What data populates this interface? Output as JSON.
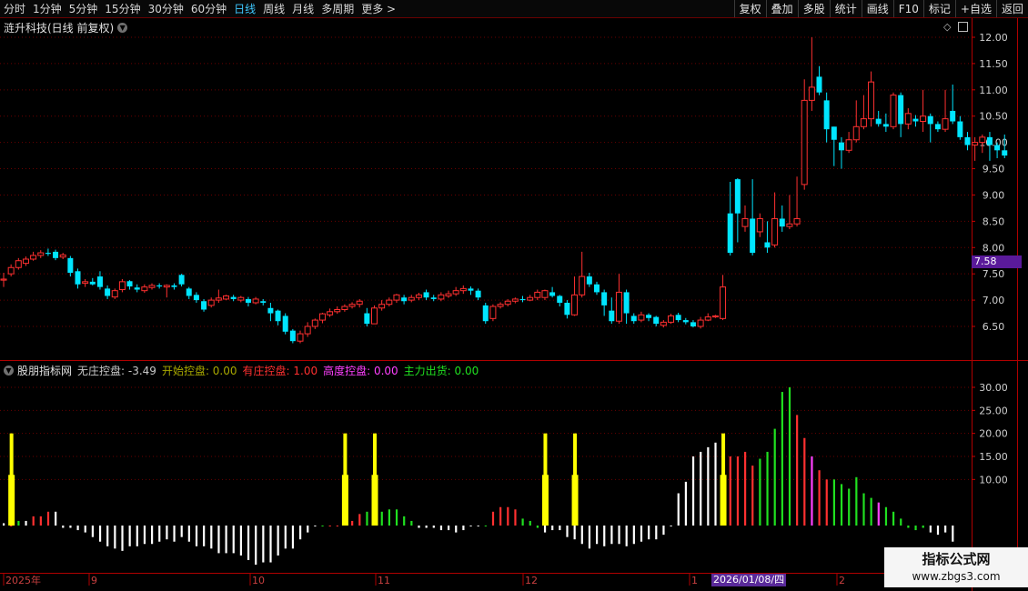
{
  "toolbar": {
    "periods": [
      "分时",
      "1分钟",
      "5分钟",
      "15分钟",
      "30分钟",
      "60分钟",
      "日线",
      "周线",
      "月线",
      "多周期",
      "更多 >"
    ],
    "active_period": "日线",
    "actions": [
      "复权",
      "叠加",
      "多股",
      "统计",
      "画线",
      "F10",
      "标记",
      "+自选",
      "返回"
    ]
  },
  "main_panel": {
    "title": "涟升科技(日线 前复权)",
    "current_price_label": "7.58",
    "price_axis_ticks": [
      "12.00",
      "11.50",
      "11.00",
      "10.50",
      "10.00",
      "9.50",
      "9.00",
      "8.50",
      "8.00",
      "7.50",
      "7.00",
      "6.50"
    ]
  },
  "indicator_panel": {
    "name": "股朋指标网",
    "values": [
      {
        "label": "无庄控盘:",
        "value": "-3.49",
        "color": "#c8c8c8"
      },
      {
        "label": "开始控盘:",
        "value": "0.00",
        "color": "#a8a800"
      },
      {
        "label": "有庄控盘:",
        "value": "1.00",
        "color": "#ff3030"
      },
      {
        "label": "高度控盘:",
        "value": "0.00",
        "color": "#ff40ff"
      },
      {
        "label": "主力出货:",
        "value": "0.00",
        "color": "#20e020"
      }
    ],
    "axis_ticks": [
      "30.00",
      "25.00",
      "20.00",
      "15.00",
      "10.00"
    ]
  },
  "time_axis": {
    "labels": [
      "2025年",
      "9",
      "10",
      "11",
      "12",
      "1",
      "2"
    ],
    "cursor_date": "2026/01/08/四"
  },
  "watermark": {
    "title": "指标公式网",
    "url": "www.zbgs3.com"
  },
  "colors": {
    "up": "#ff3030",
    "down": "#00e5ff",
    "grid": "#6a0000",
    "bg": "#000000"
  },
  "chart_data": [
    {
      "type": "candlestick",
      "ylim": [
        6.1,
        12.25
      ],
      "note_values_order": "open, close, high, low",
      "candles": [
        [
          7.38,
          7.4,
          7.52,
          7.25
        ],
        [
          7.5,
          7.62,
          7.68,
          7.45
        ],
        [
          7.62,
          7.75,
          7.8,
          7.58
        ],
        [
          7.7,
          7.78,
          7.83,
          7.65
        ],
        [
          7.78,
          7.85,
          7.92,
          7.75
        ],
        [
          7.85,
          7.9,
          7.95,
          7.8
        ],
        [
          7.9,
          7.88,
          7.98,
          7.84
        ],
        [
          7.92,
          7.8,
          7.96,
          7.76
        ],
        [
          7.82,
          7.86,
          7.9,
          7.78
        ],
        [
          7.8,
          7.52,
          7.84,
          7.45
        ],
        [
          7.55,
          7.3,
          7.6,
          7.22
        ],
        [
          7.32,
          7.35,
          7.4,
          7.25
        ],
        [
          7.35,
          7.3,
          7.42,
          7.28
        ],
        [
          7.45,
          7.25,
          7.55,
          7.2
        ],
        [
          7.22,
          7.08,
          7.28,
          7.02
        ],
        [
          7.06,
          7.18,
          7.22,
          7.02
        ],
        [
          7.2,
          7.35,
          7.4,
          7.15
        ],
        [
          7.36,
          7.26,
          7.38,
          7.2
        ],
        [
          7.24,
          7.2,
          7.3,
          7.15
        ],
        [
          7.18,
          7.25,
          7.3,
          7.14
        ],
        [
          7.24,
          7.28,
          7.32,
          7.2
        ],
        [
          7.28,
          7.26,
          7.32,
          7.22
        ],
        [
          7.25,
          7.28,
          7.3,
          7.05
        ],
        [
          7.28,
          7.25,
          7.32,
          7.2
        ],
        [
          7.48,
          7.3,
          7.5,
          7.26
        ],
        [
          7.22,
          7.08,
          7.25,
          7.02
        ],
        [
          7.1,
          7.0,
          7.15,
          6.95
        ],
        [
          6.98,
          6.82,
          7.02,
          6.78
        ],
        [
          6.9,
          7.0,
          7.05,
          6.86
        ],
        [
          7.0,
          7.04,
          7.2,
          6.95
        ],
        [
          7.02,
          7.08,
          7.1,
          7.0
        ],
        [
          7.06,
          7.02,
          7.1,
          6.98
        ],
        [
          7.0,
          7.05,
          7.08,
          6.96
        ],
        [
          7.02,
          6.95,
          7.06,
          6.88
        ],
        [
          6.95,
          7.02,
          7.06,
          6.92
        ],
        [
          6.98,
          6.95,
          7.02,
          6.9
        ],
        [
          6.85,
          6.75,
          6.95,
          6.6
        ],
        [
          6.8,
          6.6,
          6.82,
          6.52
        ],
        [
          6.7,
          6.4,
          6.75,
          6.35
        ],
        [
          6.42,
          6.22,
          6.45,
          6.18
        ],
        [
          6.22,
          6.36,
          6.42,
          6.18
        ],
        [
          6.36,
          6.5,
          6.58,
          6.3
        ],
        [
          6.5,
          6.62,
          6.65,
          6.45
        ],
        [
          6.62,
          6.74,
          6.76,
          6.56
        ],
        [
          6.72,
          6.78,
          6.84,
          6.68
        ],
        [
          6.78,
          6.82,
          6.88,
          6.74
        ],
        [
          6.82,
          6.88,
          6.92,
          6.78
        ],
        [
          6.88,
          6.92,
          6.96,
          6.84
        ],
        [
          6.92,
          6.98,
          7.02,
          6.86
        ],
        [
          6.75,
          6.55,
          6.85,
          6.5
        ],
        [
          6.55,
          6.85,
          6.9,
          6.55
        ],
        [
          6.85,
          6.92,
          7.0,
          6.8
        ],
        [
          6.92,
          7.0,
          7.05,
          6.88
        ],
        [
          7.0,
          7.1,
          7.12,
          6.95
        ],
        [
          7.05,
          6.98,
          7.1,
          6.92
        ],
        [
          7.0,
          7.05,
          7.1,
          6.96
        ],
        [
          7.05,
          7.1,
          7.14,
          7.0
        ],
        [
          7.15,
          7.05,
          7.2,
          7.0
        ],
        [
          7.05,
          7.02,
          7.1,
          6.98
        ],
        [
          7.02,
          7.1,
          7.15,
          6.98
        ],
        [
          7.08,
          7.12,
          7.18,
          7.04
        ],
        [
          7.12,
          7.18,
          7.25,
          7.08
        ],
        [
          7.18,
          7.22,
          7.28,
          7.12
        ],
        [
          7.22,
          7.18,
          7.26,
          7.1
        ],
        [
          7.18,
          7.05,
          7.22,
          7.0
        ],
        [
          6.9,
          6.6,
          6.95,
          6.55
        ],
        [
          6.65,
          6.88,
          6.92,
          6.6
        ],
        [
          6.88,
          6.92,
          6.96,
          6.84
        ],
        [
          6.92,
          6.98,
          7.02,
          6.88
        ],
        [
          6.98,
          7.02,
          7.05,
          6.94
        ],
        [
          7.02,
          7.0,
          7.08,
          6.96
        ],
        [
          7.0,
          7.05,
          7.1,
          6.98
        ],
        [
          7.05,
          7.15,
          7.2,
          7.0
        ],
        [
          7.05,
          7.18,
          7.2,
          7.0
        ],
        [
          7.15,
          7.08,
          7.25,
          7.05
        ],
        [
          7.08,
          6.95,
          7.1,
          6.88
        ],
        [
          6.95,
          6.72,
          7.0,
          6.65
        ],
        [
          6.72,
          7.1,
          7.45,
          6.7
        ],
        [
          7.1,
          7.45,
          7.92,
          7.05
        ],
        [
          7.45,
          7.3,
          7.52,
          7.25
        ],
        [
          7.3,
          7.15,
          7.35,
          7.1
        ],
        [
          7.15,
          6.9,
          7.2,
          6.7
        ],
        [
          6.8,
          6.6,
          7.05,
          6.55
        ],
        [
          6.6,
          7.15,
          7.5,
          6.55
        ],
        [
          7.15,
          6.75,
          7.2,
          6.55
        ],
        [
          6.7,
          6.6,
          6.75,
          6.55
        ],
        [
          6.62,
          6.72,
          6.78,
          6.58
        ],
        [
          6.72,
          6.66,
          6.75,
          6.6
        ],
        [
          6.68,
          6.55,
          6.7,
          6.5
        ],
        [
          6.52,
          6.58,
          6.62,
          6.48
        ],
        [
          6.58,
          6.7,
          6.74,
          6.55
        ],
        [
          6.72,
          6.62,
          6.76,
          6.58
        ],
        [
          6.62,
          6.58,
          6.66,
          6.54
        ],
        [
          6.58,
          6.5,
          6.62,
          6.48
        ],
        [
          6.5,
          6.62,
          6.68,
          6.46
        ],
        [
          6.62,
          6.68,
          6.75,
          6.6
        ],
        [
          6.68,
          6.7,
          6.72,
          6.66
        ],
        [
          6.65,
          7.25,
          7.48,
          6.62
        ],
        [
          8.65,
          7.9,
          9.25,
          7.85
        ],
        [
          9.3,
          8.65,
          9.32,
          8.1
        ],
        [
          8.4,
          8.55,
          8.8,
          8.3
        ],
        [
          8.55,
          7.9,
          9.3,
          7.85
        ],
        [
          8.3,
          8.55,
          8.65,
          8.2
        ],
        [
          8.1,
          8.0,
          8.5,
          7.9
        ],
        [
          8.05,
          8.55,
          9.05,
          8.0
        ],
        [
          8.55,
          8.4,
          8.8,
          8.3
        ],
        [
          8.4,
          8.45,
          9.0,
          8.35
        ],
        [
          8.45,
          8.55,
          9.35,
          8.4
        ],
        [
          9.2,
          10.8,
          11.2,
          9.1
        ],
        [
          10.8,
          11.05,
          12.0,
          10.6
        ],
        [
          11.25,
          10.95,
          11.45,
          10.9
        ],
        [
          10.8,
          10.25,
          10.95,
          10.0
        ],
        [
          10.3,
          10.05,
          10.3,
          9.55
        ],
        [
          10.0,
          9.85,
          10.1,
          9.5
        ],
        [
          9.85,
          10.05,
          10.2,
          9.8
        ],
        [
          10.05,
          10.3,
          10.8,
          10.0
        ],
        [
          10.3,
          10.45,
          10.9,
          10.25
        ],
        [
          10.45,
          11.15,
          11.35,
          10.3
        ],
        [
          10.45,
          10.35,
          10.6,
          10.3
        ],
        [
          10.35,
          10.3,
          10.55,
          10.2
        ],
        [
          10.3,
          10.9,
          10.95,
          10.25
        ],
        [
          10.9,
          10.35,
          10.95,
          10.1
        ],
        [
          10.35,
          10.55,
          10.65,
          10.25
        ],
        [
          10.45,
          10.4,
          10.52,
          10.3
        ],
        [
          10.4,
          10.5,
          11.0,
          10.2
        ],
        [
          10.5,
          10.35,
          10.55,
          10.0
        ],
        [
          10.35,
          10.25,
          10.4,
          10.2
        ],
        [
          10.25,
          10.45,
          11.0,
          10.2
        ],
        [
          10.6,
          10.4,
          11.1,
          10.35
        ],
        [
          10.4,
          10.1,
          10.5,
          10.05
        ],
        [
          10.1,
          9.95,
          10.2,
          9.85
        ],
        [
          9.95,
          10.0,
          10.1,
          9.65
        ],
        [
          10.0,
          10.1,
          10.15,
          9.8
        ],
        [
          10.1,
          9.95,
          10.2,
          9.65
        ],
        [
          9.95,
          9.85,
          10.0,
          9.7
        ],
        [
          9.85,
          9.75,
          10.15,
          9.7
        ]
      ]
    },
    {
      "type": "bar",
      "title": "股朋指标网",
      "ylim": [
        -8,
        33
      ],
      "series_colors": [
        "#ffffff",
        "#ffff00",
        "#ff3030",
        "#ff40ff",
        "#20e020"
      ],
      "values": [
        0.5,
        0,
        1,
        1,
        2,
        2,
        3,
        3,
        -0.5,
        -0.5,
        -1,
        -1.5,
        -2.5,
        -3.5,
        -4.5,
        -5,
        -5.5,
        -4.5,
        -4.5,
        -4,
        -4,
        -3.5,
        -3,
        -3.5,
        -2.5,
        -3.5,
        -4.5,
        -4.5,
        -5,
        -6,
        -6,
        -6,
        -6.5,
        -7.5,
        -8.5,
        -8,
        -8,
        -6.5,
        -5,
        -5,
        -3,
        -1.5,
        0,
        0,
        0,
        0,
        1,
        1,
        2.5,
        3,
        3,
        3,
        3.5,
        3.5,
        2,
        1,
        -0.5,
        -0.5,
        -0.5,
        -1,
        -1,
        -1.5,
        -1,
        0,
        0,
        0,
        3,
        4,
        4,
        3.5,
        1.5,
        1,
        -0.5,
        -1.5,
        -1,
        -1,
        -2.5,
        -3,
        -4,
        -5,
        -4,
        -4.5,
        -4,
        -4,
        -4.5,
        -4,
        -3.5,
        -3,
        -3,
        -2,
        0,
        7,
        9.5,
        15,
        16,
        17,
        18,
        16,
        15,
        15,
        16,
        13,
        14.5,
        16,
        21,
        29,
        30,
        24,
        19,
        15,
        12,
        10,
        10,
        9,
        8,
        10.5,
        7,
        6,
        5,
        4,
        3,
        1.5,
        -0.5,
        -1,
        -0.5,
        -1.5,
        -2,
        -1.5,
        -3.5
      ],
      "colors_key": "wrgbrrrwwwwwwwwwwwwwwwwwwwwwwwwwwwwwwwwwwwwgrrrrrgrgggggwwwwwwwwwgrrrrgggwwwwwwwwwwwwwwwwwwwwwwwwmrrrrgggggrrmrrggggggmggggggwwwwwww",
      "yellow_bar_indices": [
        1,
        46,
        50,
        73,
        77,
        97
      ]
    }
  ]
}
